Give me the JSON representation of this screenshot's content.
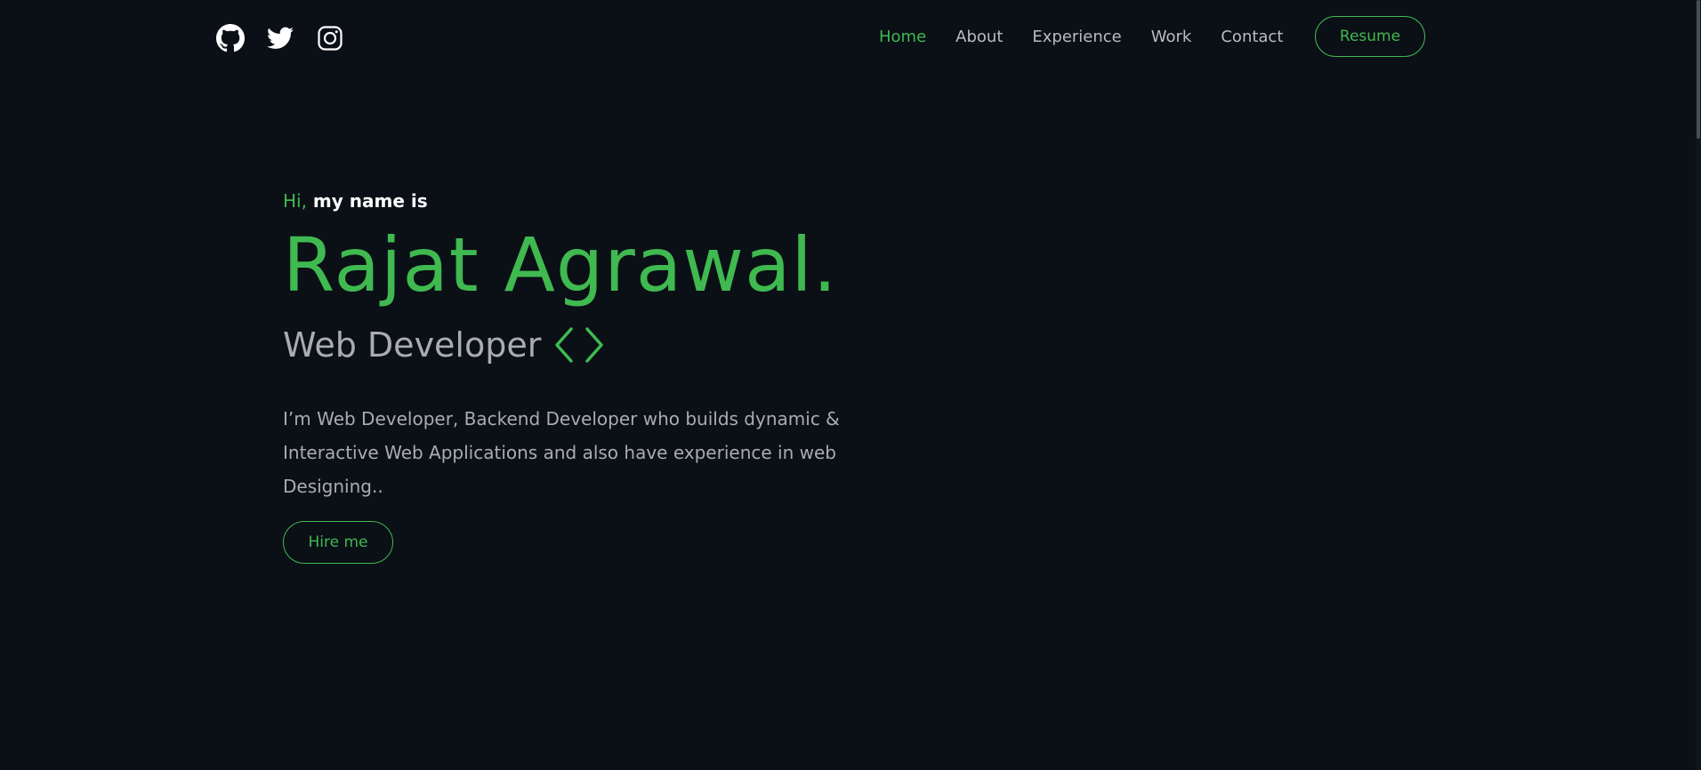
{
  "colors": {
    "background": "#0b0f16",
    "accent": "#3fb950",
    "text_muted": "#a9acb2",
    "text_white": "#ffffff"
  },
  "header": {
    "socials": [
      {
        "icon": "github-icon"
      },
      {
        "icon": "twitter-icon"
      },
      {
        "icon": "instagram-icon"
      }
    ],
    "nav": [
      {
        "label": "Home",
        "active": true
      },
      {
        "label": "About",
        "active": false
      },
      {
        "label": "Experience",
        "active": false
      },
      {
        "label": "Work",
        "active": false
      },
      {
        "label": "Contact",
        "active": false
      }
    ],
    "resume_label": "Resume"
  },
  "hero": {
    "greeting_hi": "Hi,",
    "greeting_rest": "my name is",
    "name": "Rajat Agrawal.",
    "role": "Web Developer",
    "role_icon": "code-brackets-icon",
    "bio": "I’m Web Developer, Backend Developer who builds dynamic & Interactive Web Applications and also have experience in web Designing..",
    "hire_label": "Hire me"
  }
}
